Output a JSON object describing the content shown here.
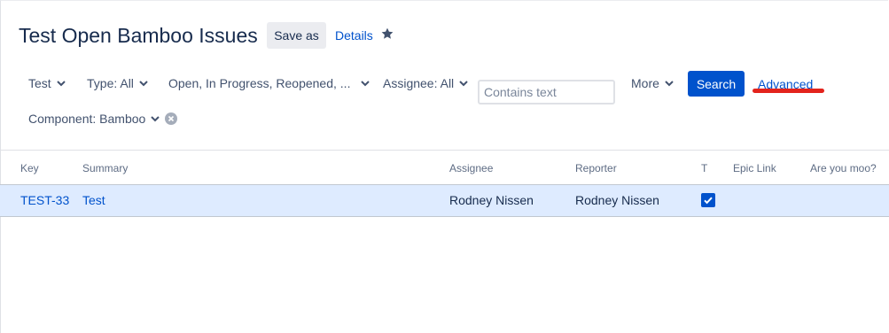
{
  "header": {
    "title": "Test Open Bamboo Issues",
    "save_as_label": "Save as",
    "details_label": "Details",
    "star_icon": "star-icon"
  },
  "filters": {
    "project": "Test",
    "type": "Type: All",
    "status": "Open, In Progress, Reopened, ...",
    "assignee": "Assignee: All",
    "text_placeholder": "Contains text",
    "more": "More",
    "component": "Component: Bamboo",
    "search_label": "Search",
    "advanced_label": "Advanced"
  },
  "table": {
    "columns": [
      "Key",
      "Summary",
      "Assignee",
      "Reporter",
      "T",
      "Epic Link",
      "Are you moo?"
    ],
    "rows": [
      {
        "key": "TEST-33",
        "summary": "Test",
        "assignee": "Rodney Nissen",
        "reporter": "Rodney Nissen",
        "t_checked": true,
        "epic_link": "",
        "are_you_moo": ""
      }
    ]
  },
  "colors": {
    "accent": "#0052cc",
    "selected_row": "#deebff",
    "annotation": "#e3231c"
  }
}
